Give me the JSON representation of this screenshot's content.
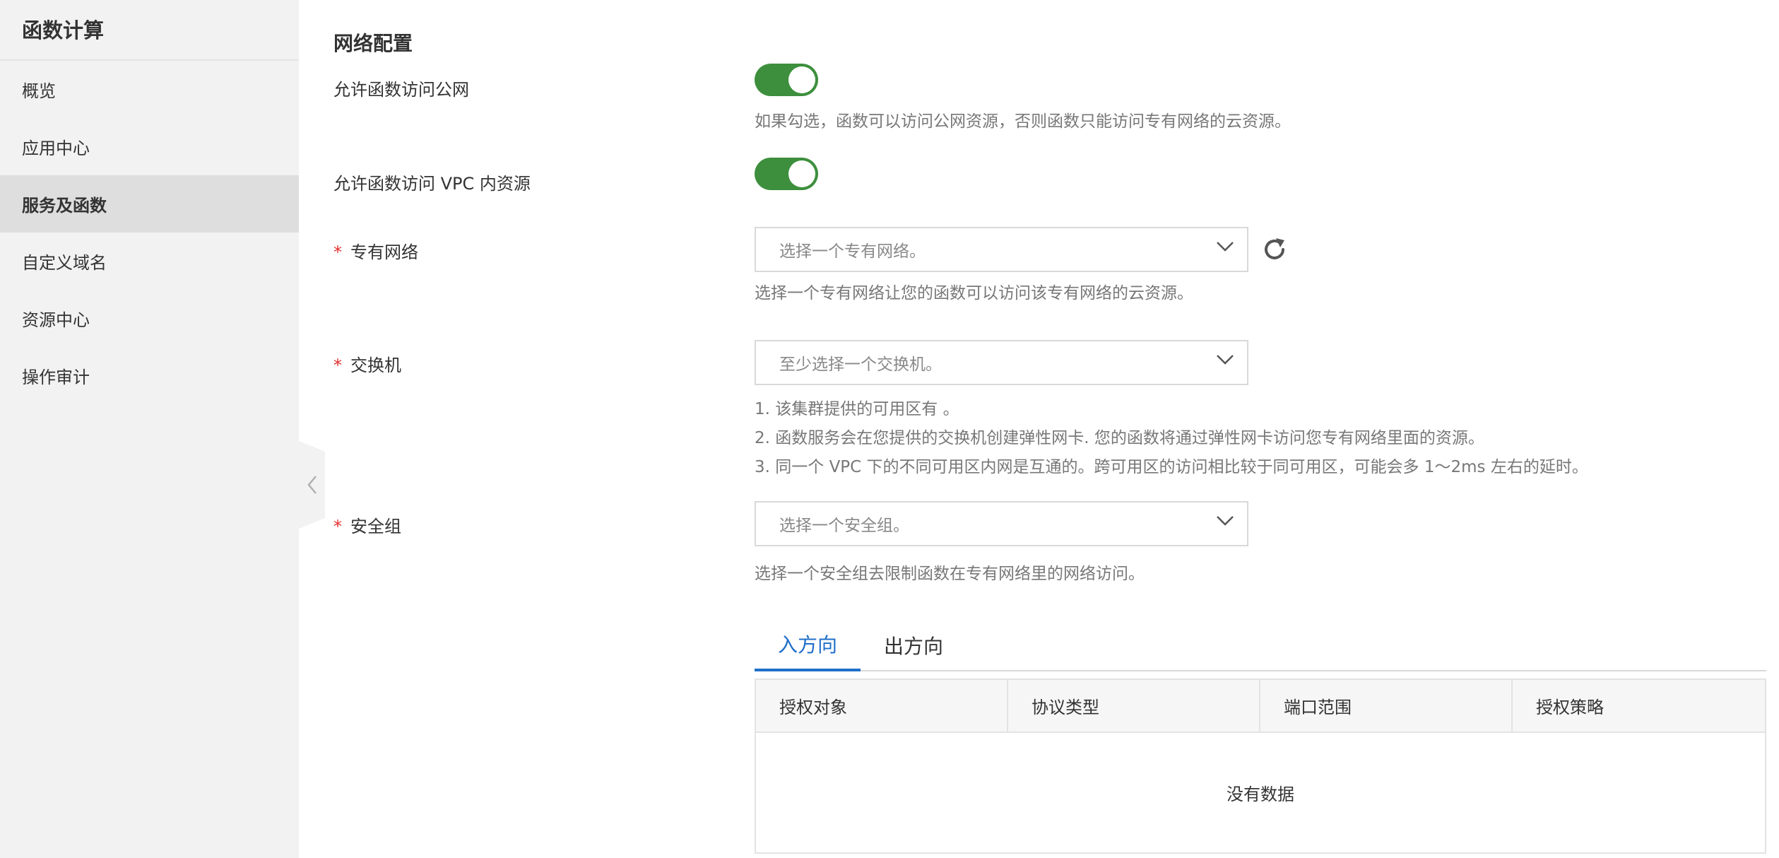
{
  "sidebar": {
    "title": "函数计算",
    "items": [
      {
        "label": "概览"
      },
      {
        "label": "应用中心"
      },
      {
        "label": "服务及函数"
      },
      {
        "label": "自定义域名"
      },
      {
        "label": "资源中心"
      },
      {
        "label": "操作审计"
      }
    ],
    "active_index": 2
  },
  "main": {
    "section_title": "网络配置",
    "public_access": {
      "label": "允许函数访问公网",
      "enabled": true,
      "help": "如果勾选，函数可以访问公网资源，否则函数只能访问专有网络的云资源。"
    },
    "vpc_access": {
      "label": "允许函数访问 VPC 内资源",
      "enabled": true
    },
    "vpc": {
      "required_mark": "*",
      "label": "专有网络",
      "placeholder": "选择一个专有网络。",
      "help": "选择一个专有网络让您的函数可以访问该专有网络的云资源。"
    },
    "vswitch": {
      "required_mark": "*",
      "label": "交换机",
      "placeholder": "至少选择一个交换机。",
      "help_lines": [
        "1. 该集群提供的可用区有 。",
        "2. 函数服务会在您提供的交换机创建弹性网卡. 您的函数将通过弹性网卡访问您专有网络里面的资源。",
        "3. 同一个 VPC 下的不同可用区内网是互通的。跨可用区的访问相比较于同可用区，可能会多 1～2ms 左右的延时。"
      ]
    },
    "security_group": {
      "required_mark": "*",
      "label": "安全组",
      "placeholder": "选择一个安全组。",
      "help": "选择一个安全组去限制函数在专有网络里的网络访问。"
    },
    "tabs": [
      {
        "label": "入方向"
      },
      {
        "label": "出方向"
      }
    ],
    "active_tab": 0,
    "table": {
      "columns": [
        "授权对象",
        "协议类型",
        "端口范围",
        "授权策略"
      ],
      "empty_text": "没有数据"
    }
  },
  "colors": {
    "toggle_on": "#3d8f3d",
    "tab_active": "#1f6fc9",
    "required": "#e52e2e"
  }
}
